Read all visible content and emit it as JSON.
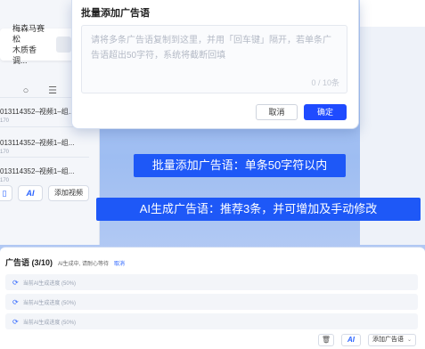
{
  "background_panel": {
    "material_card_text_line1": "梅森马赛松",
    "material_card_text_line2": "木质香调...",
    "video_items": [
      {
        "title": "013114352–视频1–组...",
        "sub": "170"
      },
      {
        "title": "013114352–视频1–组...",
        "sub": "170"
      },
      {
        "title": "013114352–视频1–组...",
        "sub": "170"
      }
    ],
    "ai_label": "AI",
    "add_video_label": "添加视频"
  },
  "dialog": {
    "title": "批量添加广告语",
    "placeholder": "请将多条广告语复制到这里，并用「回车键」隔开，若单条广告语超出50字符，系统将截断回填",
    "counter": "0 / 10条",
    "cancel_label": "取消",
    "confirm_label": "确定"
  },
  "banners": {
    "batch": "批量添加广告语：单条50字符以内",
    "ai": "AI生成广告语：推荐3条，并可增加及手动修改"
  },
  "bottom_panel": {
    "title": "广告语 (3/10)",
    "hint": "AI生成中, 请耐心等待",
    "cancel_link": "取消",
    "rows": [
      {
        "text": "当前AI生成进度 (50%)",
        "progress": 50
      },
      {
        "text": "当前AI生成进度 (50%)",
        "progress": 50
      },
      {
        "text": "当前AI生成进度 (50%)",
        "progress": 50
      }
    ],
    "ai_label": "AI",
    "add_label": "添加广告语"
  },
  "colors": {
    "accent": "#1f4bff",
    "banner": "#1e58f7"
  }
}
